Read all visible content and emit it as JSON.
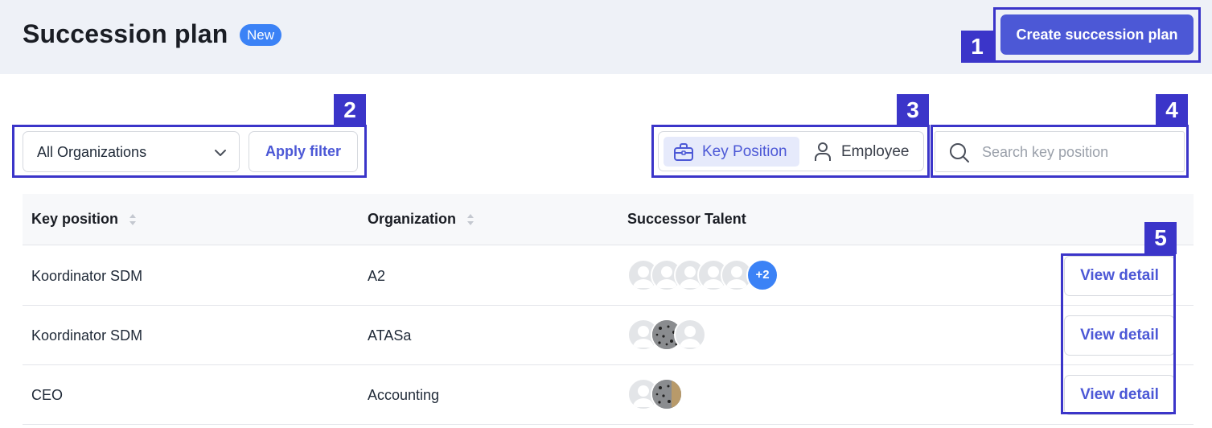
{
  "header": {
    "title": "Succession plan",
    "badge": "New",
    "create_button": "Create succession plan"
  },
  "filters": {
    "organization_select": "All Organizations",
    "apply_button": "Apply filter"
  },
  "view_toggle": {
    "key_position": "Key Position",
    "employee": "Employee",
    "selected": "Key Position"
  },
  "search": {
    "placeholder": "Search key position",
    "value": ""
  },
  "callouts": [
    "1",
    "2",
    "3",
    "4",
    "5"
  ],
  "table": {
    "columns": [
      "Key position",
      "Organization",
      "Successor Talent"
    ],
    "rows": [
      {
        "key_position": "Koordinator SDM",
        "organization": "A2",
        "avatar_count": 5,
        "extra": "+2",
        "action": "View detail"
      },
      {
        "key_position": "Koordinator SDM",
        "organization": "ATASa",
        "avatar_count": 3,
        "extra": "",
        "action": "View detail"
      },
      {
        "key_position": "CEO",
        "organization": "Accounting",
        "avatar_count": 2,
        "extra": "",
        "action": "View detail"
      }
    ]
  },
  "colors": {
    "primary": "#4c58d6",
    "badge": "#3b82f6",
    "callout": "#3b35c9",
    "header_bg": "#eef1f7"
  }
}
